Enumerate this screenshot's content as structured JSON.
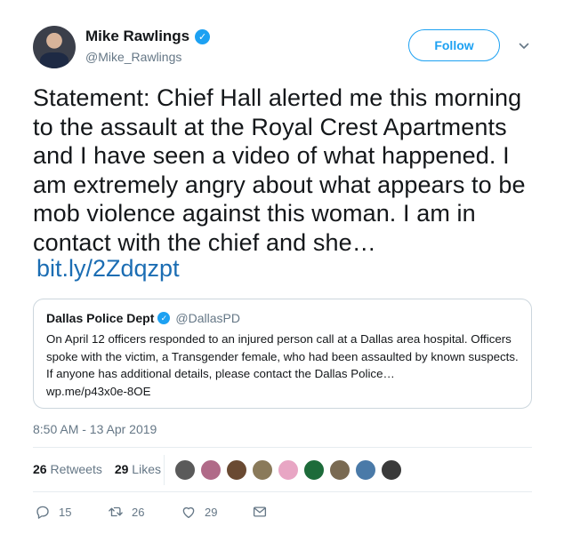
{
  "author": {
    "display_name": "Mike Rawlings",
    "handle": "@Mike_Rawlings",
    "verified_icon": "verified-badge-icon"
  },
  "header": {
    "follow_label": "Follow"
  },
  "tweet": {
    "text": "Statement: Chief Hall alerted me this morning to the assault at the Royal Crest Apartments and I have seen a video of what happened. I am extremely angry about what appears to be mob violence against this woman. I am in contact with the chief and she…",
    "link": "bit.ly/2Zdqzpt",
    "timestamp": "8:50 AM - 13 Apr 2019"
  },
  "quote": {
    "display_name": "Dallas Police Dept",
    "handle": "@DallasPD",
    "text": "On April 12 officers responded to an injured person call at a Dallas area hospital. Officers spoke with the victim, a Transgender female, who had been assaulted by known suspects. If anyone has additional details, please contact the Dallas Police…",
    "link": "wp.me/p43x0e-8OE"
  },
  "stats": {
    "retweets_count": "26",
    "retweets_label": "Retweets",
    "likes_count": "29",
    "likes_label": "Likes"
  },
  "likers": [
    {
      "color": "#5a5a5a"
    },
    {
      "color": "#b06a88"
    },
    {
      "color": "#6a4a32"
    },
    {
      "color": "#8a7a5a"
    },
    {
      "color": "#e8a6c4"
    },
    {
      "color": "#1d6b3a"
    },
    {
      "color": "#7a6a52"
    },
    {
      "color": "#4a7aa8"
    },
    {
      "color": "#3a3a3a"
    }
  ],
  "actions": {
    "reply_count": "15",
    "retweet_count": "26",
    "like_count": "29"
  },
  "colors": {
    "accent": "#1da1f2",
    "link": "#1b6db3",
    "muted": "#657786"
  }
}
